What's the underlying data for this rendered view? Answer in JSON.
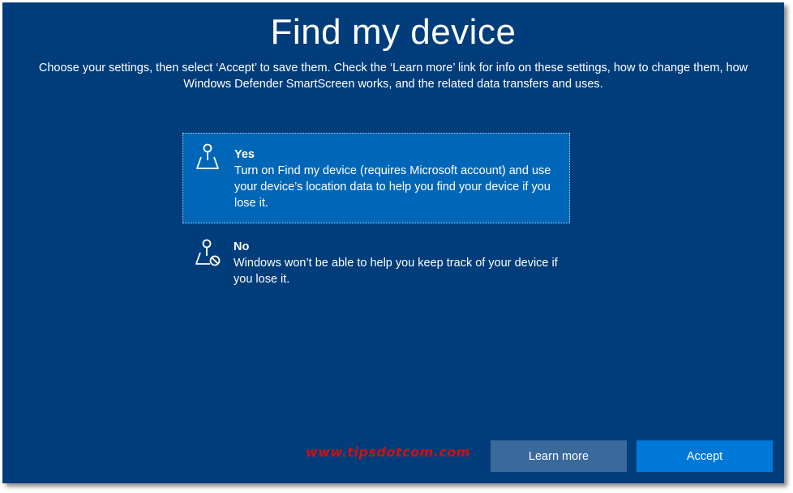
{
  "page": {
    "title": "Find my device",
    "intro": "Choose your settings, then select ‘Accept’ to save them. Check the ‘Learn more’ link for info on these settings, how to change them, how Windows Defender SmartScreen works, and the related data transfers and uses."
  },
  "options": [
    {
      "heading": "Yes",
      "description": "Turn on Find my device (requires Microsoft account) and use your device’s location data to help you find your device if you lose it.",
      "selected": true,
      "icon": "map-pin-icon"
    },
    {
      "heading": "No",
      "description": "Windows won’t be able to help you keep track of your device if you lose it.",
      "selected": false,
      "icon": "map-pin-blocked-icon"
    }
  ],
  "watermark": "www.tipsdotcom.com",
  "buttons": {
    "learn_more": "Learn more",
    "accept": "Accept"
  },
  "colors": {
    "background": "#003d7a",
    "selected_option": "#0067b8",
    "learn_more_button": "#3a6a9c",
    "accept_button": "#0078d7",
    "watermark": "#cc1111"
  }
}
